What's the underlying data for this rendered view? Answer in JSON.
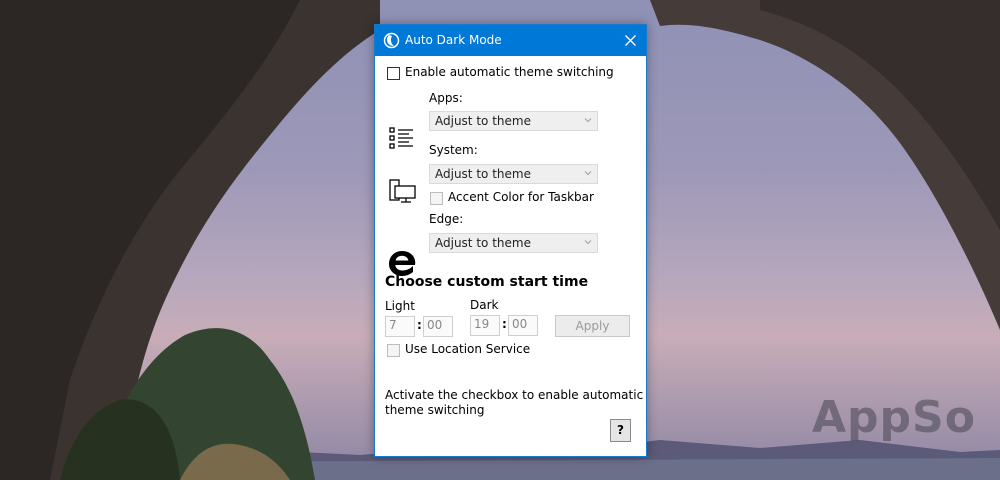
{
  "window": {
    "title": "Auto Dark Mode",
    "close_icon": "close-icon",
    "app_icon": "moon-icon"
  },
  "settings": {
    "enable_label": "Enable automatic theme switching",
    "enable_checked": false,
    "apps": {
      "label": "Apps:",
      "value": "Adjust to theme",
      "icon": "list-icon"
    },
    "system": {
      "label": "System:",
      "value": "Adjust to theme",
      "icon": "monitor-icon"
    },
    "accent_label": "Accent Color for Taskbar",
    "edge": {
      "label": "Edge:",
      "value": "Adjust to theme",
      "icon": "edge-icon"
    }
  },
  "schedule": {
    "heading": "Choose custom start time",
    "light_label": "Light",
    "dark_label": "Dark",
    "light_hour": "7",
    "light_minute": "00",
    "dark_hour": "19",
    "dark_minute": "00",
    "separator": ":",
    "apply_label": "Apply",
    "location_label": "Use Location Service"
  },
  "info_text": "Activate the checkbox to enable automatic theme switching",
  "help_label": "?",
  "desktop": {
    "watermark": "AppSo"
  },
  "colors": {
    "titlebar": "#0078d7",
    "window_border": "#1979ca"
  }
}
